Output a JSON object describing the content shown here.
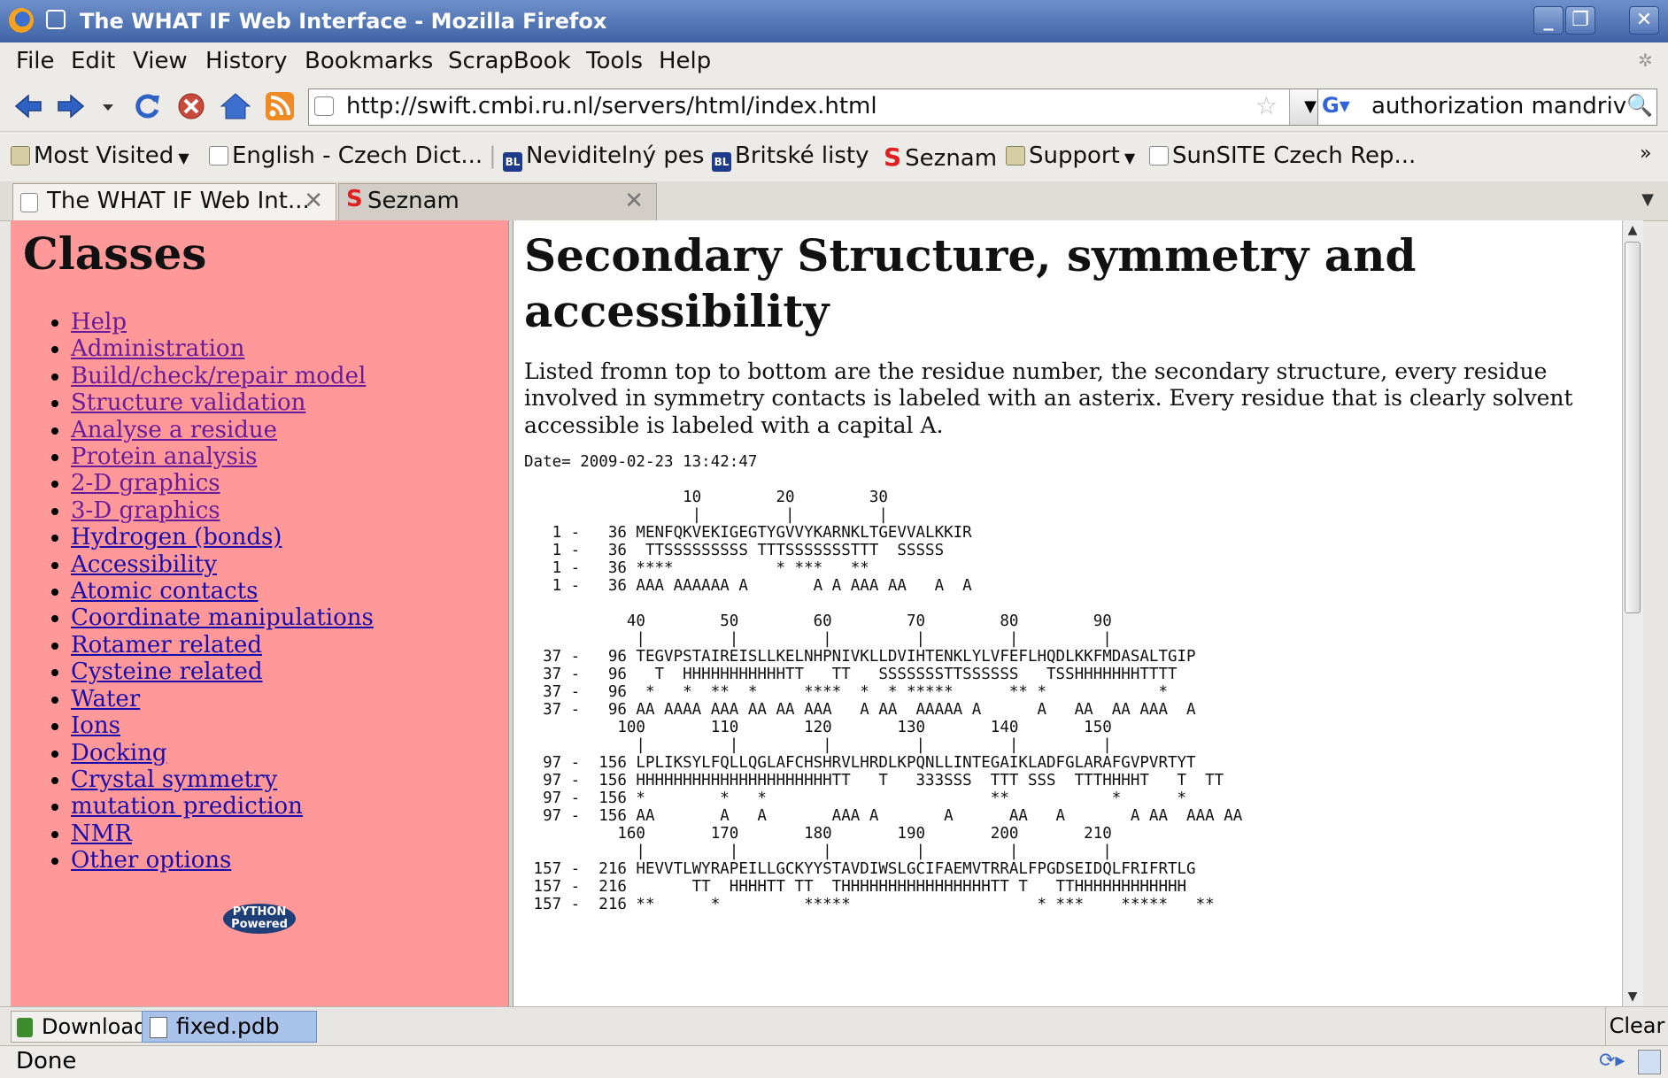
{
  "window": {
    "title": "The WHAT IF Web Interface - Mozilla Firefox"
  },
  "menu": [
    "File",
    "Edit",
    "View",
    "History",
    "Bookmarks",
    "ScrapBook",
    "Tools",
    "Help"
  ],
  "nav": {
    "url": "http://swift.cmbi.ru.nl/servers/html/index.html",
    "search_value": "authorization mandriva"
  },
  "bookmarks": [
    {
      "label": "Most Visited",
      "icon": "most-visited-icon"
    },
    {
      "label": "English - Czech Dict...",
      "icon": "page-icon"
    },
    {
      "label": "Neviditelný pes",
      "icon": "bl-icon"
    },
    {
      "label": "Britské listy",
      "icon": "bl-icon"
    },
    {
      "label": "Seznam",
      "icon": "seznam-icon"
    },
    {
      "label": "Support",
      "icon": "folder-icon"
    },
    {
      "label": "SunSITE Czech Rep...",
      "icon": "page-icon"
    }
  ],
  "tabs": [
    {
      "label": "The WHAT IF Web Int...",
      "active": true
    },
    {
      "label": "Seznam",
      "active": false
    }
  ],
  "sidebar": {
    "title": "Classes",
    "items": [
      "Help",
      "Administration",
      "Build/check/repair model",
      "Structure validation",
      "Analyse a residue",
      "Protein analysis",
      "2-D graphics",
      "3-D graphics",
      "Hydrogen (bonds)",
      "Accessibility",
      "Atomic contacts",
      "Coordinate manipulations",
      "Rotamer related",
      "Cysteine related",
      "Water",
      "Ions",
      "Docking",
      "Crystal symmetry",
      "mutation prediction",
      "NMR",
      "Other options"
    ],
    "logo_text": "PYTHON Powered"
  },
  "main": {
    "heading": "Secondary Structure, symmetry and accessibility",
    "description": "Listed fromn top to bottom are the residue number, the secondary structure, every residue involved in symmetry contacts is labeled with an asterix. Every residue that is clearly solvent accessible is labeled with a capital A.",
    "date": "Date= 2009-02-23 13:42:47",
    "sequence_block": "                 10        20        30\n                  |         |         |\n   1 -   36 MENFQKVEKIGEGTYGVVYKARNKLTGEVVALKKIR\n   1 -   36  TTSSSSSSSSS TTTSSSSSSSTTT  SSSSS\n   1 -   36 ****           * ***   **\n   1 -   36 AAA AAAAAA A       A A AAA AA   A  A\n\n           40        50        60        70        80        90\n            |         |         |         |         |         |\n  37 -   96 TEGVPSTAIREISLLKELNHPNIVKLLDVIHTENKLYLVFEFLHQDLKKFMDASALTGIP\n  37 -   96   T  HHHHHHHHHHHTT   TT   SSSSSSSTTSSSSSS   TSSHHHHHHHTTTT\n  37 -   96  *   *  **  *     ****  *  * *****      ** *            *\n  37 -   96 AA AAAA AAA AA AA AAA   A AA  AAAAA A      A   AA  AA AAA  A\n          100       110       120       130       140       150\n            |         |         |         |         |         |\n  97 -  156 LPLIKSYLFQLLQGLAFCHSHRVLHRDLKPQNLLINTEGAIKLADFGLARAFGVPVRTYT\n  97 -  156 HHHHHHHHHHHHHHHHHHHHHTT   T   333SSS  TTT SSS  TTTHHHHT   T  TT\n  97 -  156 *        *   *                        **           *      *\n  97 -  156 AA       A   A       AAA A       A      AA   A       A AA  AAA AA\n          160       170       180       190       200       210\n            |         |         |         |         |         |\n 157 -  216 HEVVTLWYRAPEILLGCKYYSTAVDIWSLGCIFAEMVTRRALFPGDSEIDQLFRIFRTLG\n 157 -  216       TT  HHHHTT TT  THHHHHHHHHHHHHHHHTT T   TTHHHHHHHHHHHH\n 157 -  216 **      *         *****                    * ***    *****   **"
  },
  "downloads": {
    "label": "Downloads",
    "file": "fixed.pdb",
    "clear": "Clear"
  },
  "status": {
    "text": "Done"
  }
}
